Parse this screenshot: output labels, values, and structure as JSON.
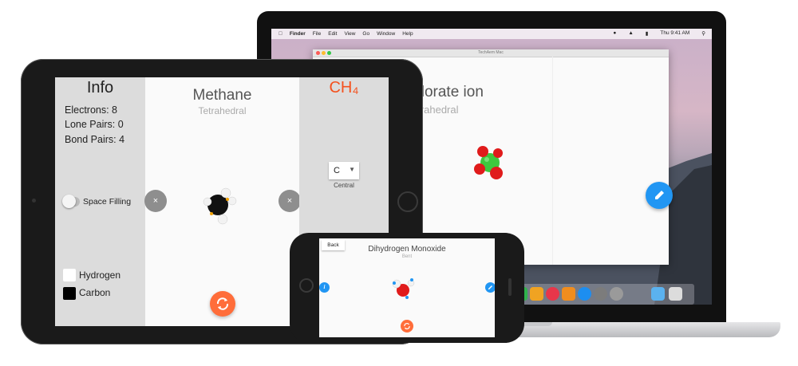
{
  "mac": {
    "menubar": {
      "items": [
        "Finder",
        "File",
        "Edit",
        "View",
        "Go",
        "Window",
        "Help"
      ],
      "clock": "Thu 9:41 AM"
    },
    "window_title": "TechAem Mac",
    "molecule_title": "Perchlorate ion",
    "molecule_shape": "Tetrahedral"
  },
  "ipad": {
    "info": {
      "title": "Info",
      "electrons": "Electrons: 8",
      "lone_pairs": "Lone Pairs: 0",
      "bond_pairs": "Bond Pairs: 4"
    },
    "toggle_label": "Space Filling",
    "legend": [
      {
        "label": "Hydrogen",
        "color": "#ffffff"
      },
      {
        "label": "Carbon",
        "color": "#000000"
      }
    ],
    "molecule_title": "Methane",
    "molecule_shape": "Tetrahedral",
    "formula": "CH₄",
    "central_select": {
      "value": "C",
      "label": "Central"
    },
    "close_glyph": "×"
  },
  "iphone": {
    "back_label": "Back",
    "molecule_title": "Dihydrogen Monoxide",
    "molecule_shape": "Bent",
    "info_glyph": "i"
  },
  "colors": {
    "accent_blue": "#2196f3",
    "accent_orange": "#ff6d3a",
    "formula_red": "#f4511e",
    "panel_gray": "#dcdcdc"
  },
  "icons": [
    "apple-icon",
    "pencil-icon",
    "refresh-icon",
    "close-icon",
    "dropdown-caret-icon",
    "info-icon"
  ]
}
